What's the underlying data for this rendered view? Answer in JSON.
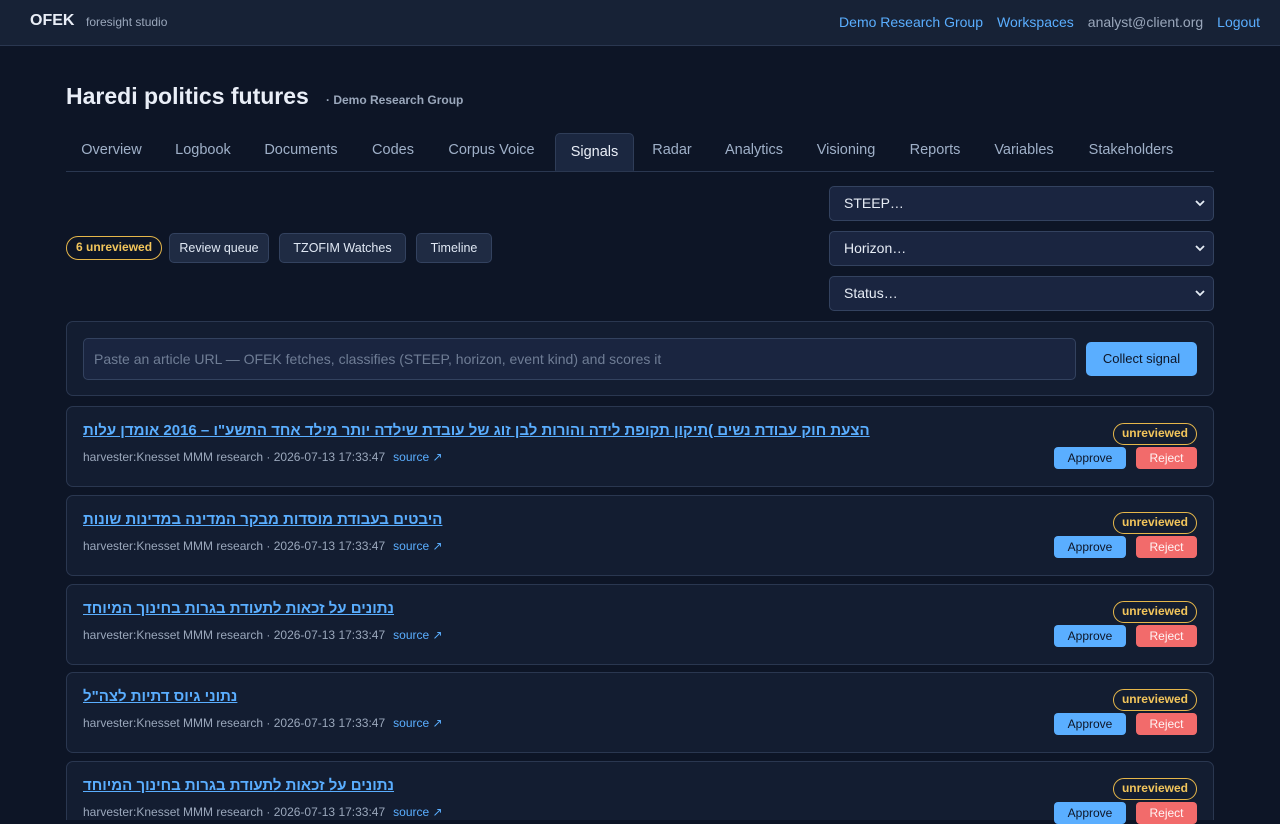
{
  "topbar": {
    "brand": "OFEK",
    "brand_sub": "foresight studio",
    "links": {
      "group": "Demo Research Group",
      "workspaces": "Workspaces",
      "user": "analyst@client.org",
      "logout": "Logout"
    }
  },
  "page": {
    "title": "Haredi politics futures",
    "subtitle": "· Demo Research Group"
  },
  "tabs": [
    "Overview",
    "Logbook",
    "Documents",
    "Codes",
    "Corpus Voice",
    "Signals",
    "Radar",
    "Analytics",
    "Visioning",
    "Reports",
    "Variables",
    "Stakeholders"
  ],
  "active_tab": "Signals",
  "toolbar": {
    "unreviewed_count": "6 unreviewed",
    "review_queue": "Review queue",
    "watches": "TZOFIM Watches",
    "timeline": "Timeline"
  },
  "filters": {
    "steep": "STEEP…",
    "horizon": "Horizon…",
    "status": "Status…"
  },
  "collect": {
    "placeholder": "Paste an article URL — OFEK fetches, classifies (STEEP, horizon, event kind) and scores it",
    "value": "",
    "button": "Collect signal"
  },
  "signals": [
    {
      "title": "הצעת חוק עבודת נשים )תיקון תקופת לידה והורות לבן זוג של עובדת שילדה יותר מילד אחד התשע\"ו – 2016 אומדן עלות",
      "meta": "harvester:Knesset MMM research · 2026-07-13 17:33:47",
      "source": "source ↗",
      "status": "unreviewed",
      "approve": "Approve",
      "reject": "Reject"
    },
    {
      "title": "היבטים בעבודת מוסדות מבקר המדינה במדינות שונות",
      "meta": "harvester:Knesset MMM research · 2026-07-13 17:33:47",
      "source": "source ↗",
      "status": "unreviewed",
      "approve": "Approve",
      "reject": "Reject"
    },
    {
      "title": "נתונים על זכאות לתעודת בגרות בחינוך המיוחד",
      "meta": "harvester:Knesset MMM research · 2026-07-13 17:33:47",
      "source": "source ↗",
      "status": "unreviewed",
      "approve": "Approve",
      "reject": "Reject"
    },
    {
      "title": "נתוני גיוס דתיות לצה\"ל",
      "meta": "harvester:Knesset MMM research · 2026-07-13 17:33:47",
      "source": "source ↗",
      "status": "unreviewed",
      "approve": "Approve",
      "reject": "Reject"
    },
    {
      "title": "נתונים על זכאות לתעודת בגרות בחינוך המיוחד",
      "meta": "harvester:Knesset MMM research · 2026-07-13 17:33:47",
      "source": "source ↗",
      "status": "unreviewed",
      "approve": "Approve",
      "reject": "Reject"
    }
  ]
}
